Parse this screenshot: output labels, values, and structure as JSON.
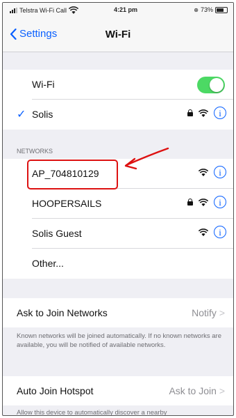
{
  "status_bar": {
    "carrier": "Telstra Wi-Fi Call",
    "time": "4:21 pm",
    "battery": "73%"
  },
  "nav": {
    "back_label": "Settings",
    "title": "Wi-Fi"
  },
  "wifi_toggle": {
    "label": "Wi-Fi",
    "enabled": true,
    "color": "#4cd964"
  },
  "connected": {
    "name": "Solis",
    "secured": true
  },
  "networks_header": "NETWORKS",
  "networks": [
    {
      "name": "AP_704810129",
      "secured": false
    },
    {
      "name": "HOOPERSAILS",
      "secured": true
    },
    {
      "name": "Solis Guest",
      "secured": false
    }
  ],
  "other_label": "Other...",
  "ask_to_join": {
    "label": "Ask to Join Networks",
    "value": "Notify"
  },
  "ask_to_join_note": "Known networks will be joined automatically. If no known networks are available, you will be notified of available networks.",
  "auto_join": {
    "label": "Auto Join Hotspot",
    "value": "Ask to Join"
  },
  "auto_join_note": "Allow this device to automatically discover a nearby",
  "accent_color": "#0a60ff",
  "annotation_color": "#dd1111"
}
